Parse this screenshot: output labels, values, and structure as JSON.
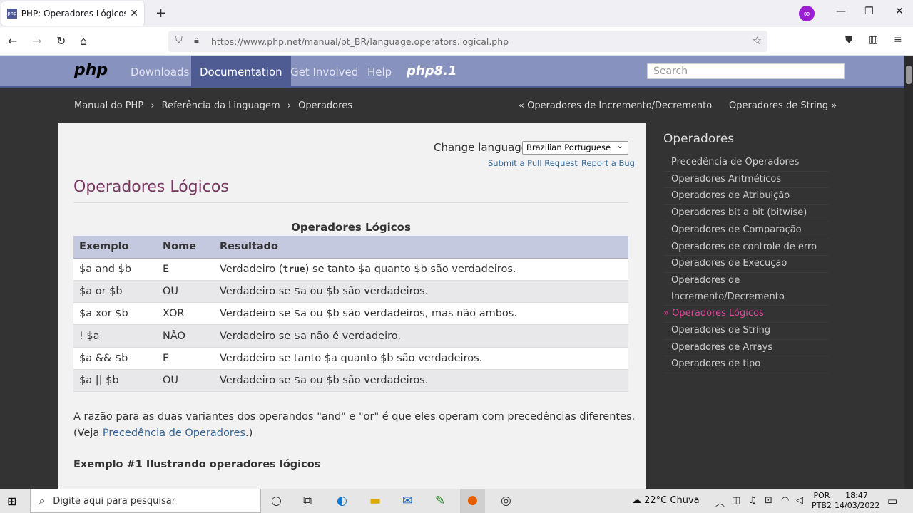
{
  "browser": {
    "tab_title": "PHP: Operadores Lógicos - Manual",
    "favicon_text": "php",
    "new_tab": "+",
    "url": "https://www.php.net/manual/pt_BR/language.operators.logical.php"
  },
  "php_header": {
    "logo": "php",
    "nav": [
      "Downloads",
      "Documentation",
      "Get Involved",
      "Help"
    ],
    "php8_badge": "php8.1",
    "search_placeholder": "Search"
  },
  "breadcrumb": {
    "items": [
      "Manual do PHP",
      "Referência da Linguagem",
      "Operadores"
    ],
    "prev": "« Operadores de Incremento/Decremento",
    "next": "Operadores de String »"
  },
  "content": {
    "change_language_label": "Change language:",
    "language_selected": "Brazilian Portuguese",
    "submit_pull": "Submit a Pull Request",
    "report_bug": "Report a Bug",
    "title": "Operadores Lógicos",
    "table": {
      "caption": "Operadores Lógicos",
      "headers": [
        "Exemplo",
        "Nome",
        "Resultado"
      ],
      "rows": [
        {
          "ex": "$a and $b",
          "name": "E",
          "res_pre": "Verdadeiro (",
          "res_code": "true",
          "res_post": ") se tanto $a quanto $b são verdadeiros."
        },
        {
          "ex": "$a or $b",
          "name": "OU",
          "res": "Verdadeiro se $a ou $b são verdadeiros."
        },
        {
          "ex": "$a xor $b",
          "name": "XOR",
          "res": "Verdadeiro se $a ou $b são verdadeiros, mas não ambos."
        },
        {
          "ex": "! $a",
          "name": "NÃO",
          "res": "Verdadeiro se $a não é verdadeiro."
        },
        {
          "ex": "$a && $b",
          "name": "E",
          "res": "Verdadeiro se tanto $a quanto $b são verdadeiros."
        },
        {
          "ex": "$a || $b",
          "name": "OU",
          "res": "Verdadeiro se $a ou $b são verdadeiros."
        }
      ]
    },
    "para_text": "A razão para as duas variantes dos operandos \"and\" e \"or\" é que eles operam com precedências diferentes. (Veja ",
    "para_link": "Precedência de Operadores",
    "para_end": ".)",
    "example_title": "Exemplo #1 Ilustrando operadores lógicos"
  },
  "sidebar": {
    "title": "Operadores",
    "items": [
      "Precedência de Operadores",
      "Operadores Aritméticos",
      "Operadores de Atribuição",
      "Operadores bit a bit (bitwise)",
      "Operadores de Comparação",
      "Operadores de controle de erro",
      "Operadores de Execução",
      "Operadores de Incremento/Decremento",
      "» Operadores Lógicos",
      "Operadores de String",
      "Operadores de Arrays",
      "Operadores de tipo"
    ]
  },
  "taskbar": {
    "search_placeholder": "Digite aqui para pesquisar",
    "weather": "22°C  Chuva",
    "lang_top": "POR",
    "lang_bottom": "PTB2",
    "time": "18:47",
    "date": "14/03/2022"
  },
  "colors": {
    "php_header": "#8892bf",
    "php_active": "#4f5b93",
    "title": "#793862",
    "link": "#336699",
    "sidebar_current": "#d8479c"
  }
}
